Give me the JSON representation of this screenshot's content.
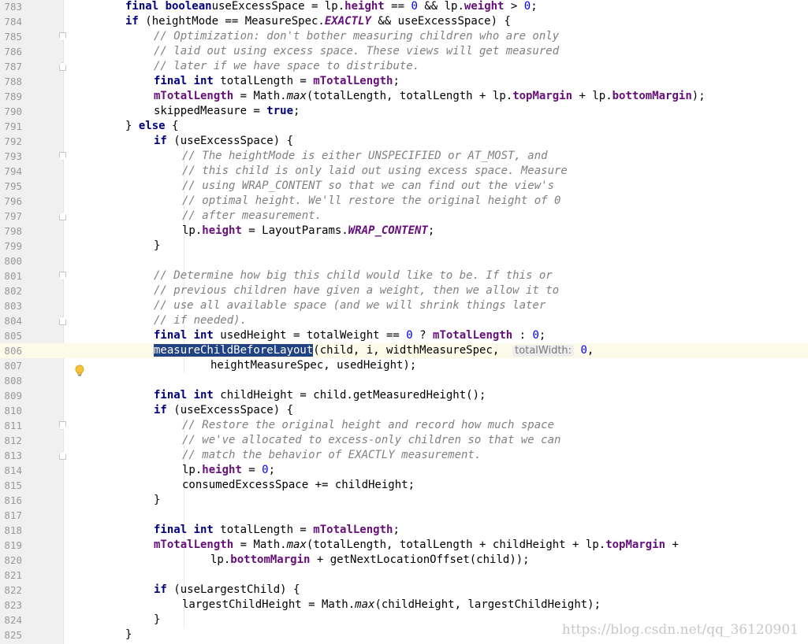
{
  "editor": {
    "current_line": 806,
    "lines": [
      {
        "n": "783",
        "indent": 4,
        "tokens": [
          [
            "kw",
            "final boolean"
          ],
          [
            "",
            "useExcessSpace = lp."
          ],
          [
            "fld",
            "height"
          ],
          [
            "",
            " == "
          ],
          [
            "num-lit",
            "0"
          ],
          [
            "",
            " && lp."
          ],
          [
            "fld",
            "weight"
          ],
          [
            "",
            " > "
          ],
          [
            "num-lit",
            "0"
          ],
          [
            "",
            ";"
          ]
        ]
      },
      {
        "n": "784",
        "indent": 4,
        "tokens": [
          [
            "kw",
            "if"
          ],
          [
            "",
            " (heightMode == MeasureSpec."
          ],
          [
            "sfld",
            "EXACTLY"
          ],
          [
            "",
            " && useExcessSpace) {"
          ]
        ]
      },
      {
        "n": "785",
        "indent": 5,
        "fold": "start",
        "tokens": [
          [
            "cm",
            "// Optimization: don't bother measuring children who are only"
          ]
        ]
      },
      {
        "n": "786",
        "indent": 5,
        "tokens": [
          [
            "cm",
            "// laid out using excess space. These views will get measured"
          ]
        ]
      },
      {
        "n": "787",
        "indent": 5,
        "fold": "end",
        "tokens": [
          [
            "cm",
            "// later if we have space to distribute."
          ]
        ]
      },
      {
        "n": "788",
        "indent": 5,
        "tokens": [
          [
            "kw",
            "final int"
          ],
          [
            "",
            " totalLength = "
          ],
          [
            "fld",
            "mTotalLength"
          ],
          [
            "",
            ";"
          ]
        ]
      },
      {
        "n": "789",
        "indent": 5,
        "tokens": [
          [
            "fld",
            "mTotalLength"
          ],
          [
            "",
            " = Math."
          ],
          [
            "smeth",
            "max"
          ],
          [
            "",
            "(totalLength, totalLength + lp."
          ],
          [
            "fld",
            "topMargin"
          ],
          [
            "",
            " + lp."
          ],
          [
            "fld",
            "bottomMargin"
          ],
          [
            "",
            ");"
          ]
        ]
      },
      {
        "n": "790",
        "indent": 5,
        "tokens": [
          [
            "",
            "skippedMeasure = "
          ],
          [
            "kw",
            "true"
          ],
          [
            "",
            ";"
          ]
        ]
      },
      {
        "n": "791",
        "indent": 4,
        "tokens": [
          [
            "",
            "} "
          ],
          [
            "kw",
            "else"
          ],
          [
            "",
            " {"
          ]
        ]
      },
      {
        "n": "792",
        "indent": 5,
        "tokens": [
          [
            "kw",
            "if"
          ],
          [
            "",
            " (useExcessSpace) {"
          ]
        ]
      },
      {
        "n": "793",
        "indent": 6,
        "fold": "start",
        "tokens": [
          [
            "cm",
            "// The heightMode is either UNSPECIFIED or AT_MOST, and"
          ]
        ]
      },
      {
        "n": "794",
        "indent": 6,
        "tokens": [
          [
            "cm",
            "// this child is only laid out using excess space. Measure"
          ]
        ]
      },
      {
        "n": "795",
        "indent": 6,
        "tokens": [
          [
            "cm",
            "// using WRAP_CONTENT so that we can find out the view's"
          ]
        ]
      },
      {
        "n": "796",
        "indent": 6,
        "tokens": [
          [
            "cm",
            "// optimal height. We'll restore the original height of 0"
          ]
        ]
      },
      {
        "n": "797",
        "indent": 6,
        "fold": "end",
        "tokens": [
          [
            "cm",
            "// after measurement."
          ]
        ]
      },
      {
        "n": "798",
        "indent": 6,
        "tokens": [
          [
            "",
            "lp."
          ],
          [
            "fld",
            "height"
          ],
          [
            "",
            " = LayoutParams."
          ],
          [
            "sfld",
            "WRAP_CONTENT"
          ],
          [
            "",
            ";"
          ]
        ]
      },
      {
        "n": "799",
        "indent": 5,
        "tokens": [
          [
            "",
            "}"
          ]
        ]
      },
      {
        "n": "800",
        "indent": 0,
        "tokens": []
      },
      {
        "n": "801",
        "indent": 5,
        "fold": "start",
        "tokens": [
          [
            "cm",
            "// Determine how big this child would like to be. If this or"
          ]
        ]
      },
      {
        "n": "802",
        "indent": 5,
        "tokens": [
          [
            "cm",
            "// previous children have given a weight, then we allow it to"
          ]
        ]
      },
      {
        "n": "803",
        "indent": 5,
        "tokens": [
          [
            "cm",
            "// use all available space (and we will shrink things later"
          ]
        ]
      },
      {
        "n": "804",
        "indent": 5,
        "fold": "end",
        "tokens": [
          [
            "cm",
            "// if needed)."
          ]
        ]
      },
      {
        "n": "805",
        "indent": 5,
        "tokens": [
          [
            "kw",
            "final int"
          ],
          [
            "",
            " usedHeight = totalWeight == "
          ],
          [
            "num-lit",
            "0"
          ],
          [
            "",
            " ? "
          ],
          [
            "fld",
            "mTotalLength"
          ],
          [
            "",
            " : "
          ],
          [
            "num-lit",
            "0"
          ],
          [
            "",
            ";"
          ]
        ]
      },
      {
        "n": "806",
        "indent": 5,
        "tokens": [
          [
            "sel",
            "measureChildBeforeLayout"
          ],
          [
            "",
            "(child, i, widthMeasureSpec,  "
          ],
          [
            "hint",
            "totalWidth:"
          ],
          [
            "",
            " "
          ],
          [
            "num-lit",
            "0"
          ],
          [
            "",
            ","
          ]
        ]
      },
      {
        "n": "807",
        "indent": 7,
        "tokens": [
          [
            "",
            "heightMeasureSpec, usedHeight);"
          ]
        ]
      },
      {
        "n": "808",
        "indent": 0,
        "tokens": []
      },
      {
        "n": "809",
        "indent": 5,
        "tokens": [
          [
            "kw",
            "final int"
          ],
          [
            "",
            " childHeight = child.getMeasuredHeight();"
          ]
        ]
      },
      {
        "n": "810",
        "indent": 5,
        "tokens": [
          [
            "kw",
            "if"
          ],
          [
            "",
            " (useExcessSpace) {"
          ]
        ]
      },
      {
        "n": "811",
        "indent": 6,
        "fold": "start",
        "tokens": [
          [
            "cm",
            "// Restore the original height and record how much space"
          ]
        ]
      },
      {
        "n": "812",
        "indent": 6,
        "tokens": [
          [
            "cm",
            "// we've allocated to excess-only children so that we can"
          ]
        ]
      },
      {
        "n": "813",
        "indent": 6,
        "fold": "end",
        "tokens": [
          [
            "cm",
            "// match the behavior of EXACTLY measurement."
          ]
        ]
      },
      {
        "n": "814",
        "indent": 6,
        "tokens": [
          [
            "",
            "lp."
          ],
          [
            "fld",
            "height"
          ],
          [
            "",
            " = "
          ],
          [
            "num-lit",
            "0"
          ],
          [
            "",
            ";"
          ]
        ]
      },
      {
        "n": "815",
        "indent": 6,
        "tokens": [
          [
            "",
            "consumedExcessSpace += childHeight;"
          ]
        ]
      },
      {
        "n": "816",
        "indent": 5,
        "tokens": [
          [
            "",
            "}"
          ]
        ]
      },
      {
        "n": "817",
        "indent": 0,
        "tokens": []
      },
      {
        "n": "818",
        "indent": 5,
        "tokens": [
          [
            "kw",
            "final int"
          ],
          [
            "",
            " totalLength = "
          ],
          [
            "fld",
            "mTotalLength"
          ],
          [
            "",
            ";"
          ]
        ]
      },
      {
        "n": "819",
        "indent": 5,
        "tokens": [
          [
            "fld",
            "mTotalLength"
          ],
          [
            "",
            " = Math."
          ],
          [
            "smeth",
            "max"
          ],
          [
            "",
            "(totalLength, totalLength + childHeight + lp."
          ],
          [
            "fld",
            "topMargin"
          ],
          [
            "",
            " +"
          ]
        ]
      },
      {
        "n": "820",
        "indent": 7,
        "tokens": [
          [
            "",
            "lp."
          ],
          [
            "fld",
            "bottomMargin"
          ],
          [
            "",
            " + getNextLocationOffset(child));"
          ]
        ]
      },
      {
        "n": "821",
        "indent": 0,
        "tokens": []
      },
      {
        "n": "822",
        "indent": 5,
        "tokens": [
          [
            "kw",
            "if"
          ],
          [
            "",
            " (useLargestChild) {"
          ]
        ]
      },
      {
        "n": "823",
        "indent": 6,
        "tokens": [
          [
            "",
            "largestChildHeight = Math."
          ],
          [
            "smeth",
            "max"
          ],
          [
            "",
            "(childHeight, largestChildHeight);"
          ]
        ]
      },
      {
        "n": "824",
        "indent": 5,
        "tokens": [
          [
            "",
            "}"
          ]
        ]
      },
      {
        "n": "825",
        "indent": 4,
        "tokens": [
          [
            "",
            "}"
          ]
        ]
      }
    ]
  },
  "watermark": "https://blog.csdn.net/qq_36120901",
  "icons": {
    "intention": "lightbulb-icon"
  }
}
